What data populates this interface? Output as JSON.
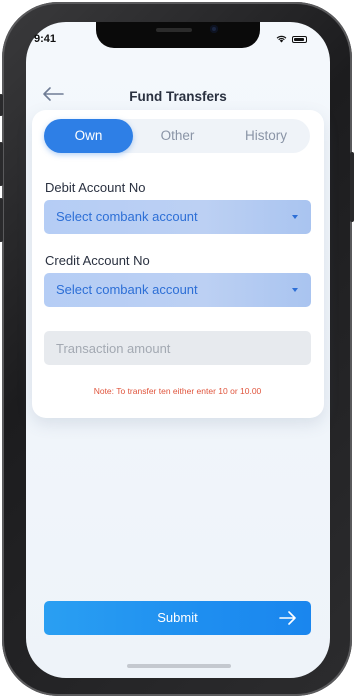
{
  "status": {
    "time": "9:41"
  },
  "header": {
    "title": "Fund Transfers"
  },
  "tabs": [
    {
      "label": "Own",
      "active": true
    },
    {
      "label": "Other",
      "active": false
    },
    {
      "label": "History",
      "active": false
    }
  ],
  "form": {
    "debit": {
      "label": "Debit Account No",
      "value": "Select combank account"
    },
    "credit": {
      "label": "Credit Account No",
      "value": "Select combank account"
    },
    "amount": {
      "placeholder": "Transaction amount",
      "value": ""
    },
    "note": "Note: To transfer ten either enter 10 or 10.00"
  },
  "submit": {
    "label": "Submit",
    "icon": "arrow-right-icon"
  },
  "back": {
    "icon": "arrow-left-icon"
  },
  "colors": {
    "primary": "#2e7fe6",
    "select_bg": "#b8cef4",
    "select_text": "#2d6fd6",
    "note": "#e0553d",
    "submit": "#1e8ef0"
  }
}
